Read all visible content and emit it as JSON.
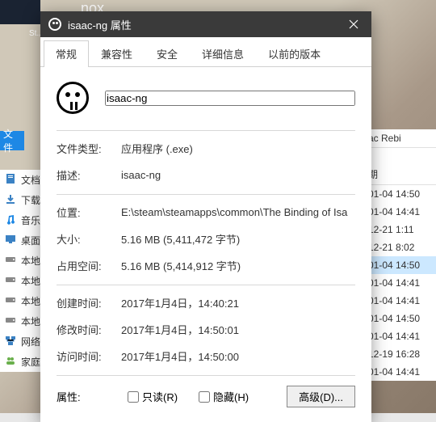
{
  "desktop": {
    "nox_label": "nox",
    "steam_label": "St..."
  },
  "dialog": {
    "title": "isaac-ng 属性",
    "tabs": [
      "常规",
      "兼容性",
      "安全",
      "详细信息",
      "以前的版本"
    ],
    "active_tab": 0,
    "filename": "isaac-ng",
    "rows": {
      "filetype_label": "文件类型:",
      "filetype_value": "应用程序 (.exe)",
      "desc_label": "描述:",
      "desc_value": "isaac-ng",
      "location_label": "位置:",
      "location_value": "E:\\steam\\steamapps\\common\\The Binding of Isa",
      "size_label": "大小:",
      "size_value": "5.16 MB (5,411,472 字节)",
      "sizedisk_label": "占用空间:",
      "sizedisk_value": "5.16 MB (5,414,912 字节)",
      "created_label": "创建时间:",
      "created_value": "2017年1月4日，14:40:21",
      "modified_label": "修改时间:",
      "modified_value": "2017年1月4日，14:50:01",
      "accessed_label": "访问时间:",
      "accessed_value": "2017年1月4日，14:50:00",
      "attr_label": "属性:",
      "readonly_label": "只读(R)",
      "hidden_label": "隐藏(H)",
      "advanced_label": "高级(D)..."
    }
  },
  "sidebar": {
    "file_btn": "文件",
    "items": [
      {
        "icon": "document",
        "label": "文档",
        "color": "#3b82c4"
      },
      {
        "icon": "download",
        "label": "下载",
        "color": "#3b82c4"
      },
      {
        "icon": "music",
        "label": "音乐",
        "color": "#1e88e5"
      },
      {
        "icon": "desktop",
        "label": "桌面",
        "color": "#3b82c4"
      },
      {
        "icon": "disk",
        "label": "本地",
        "color": "#888"
      },
      {
        "icon": "disk",
        "label": "本地",
        "color": "#888"
      },
      {
        "icon": "disk",
        "label": "本地",
        "color": "#888"
      },
      {
        "icon": "disk",
        "label": "本地",
        "color": "#888"
      },
      {
        "icon": "network",
        "label": "网络",
        "color": "#3b82c4"
      },
      {
        "icon": "homegroup",
        "label": "家庭组",
        "color": "#6ab04c"
      }
    ]
  },
  "right_col": {
    "header": "ac Rebi",
    "date_header": "期",
    "rows": [
      {
        "text": "01-04 14:50",
        "sel": false
      },
      {
        "text": "01-04 14:41",
        "sel": false
      },
      {
        "text": "12-21 1:11",
        "sel": false
      },
      {
        "text": "12-21 8:02",
        "sel": false
      },
      {
        "text": "01-04 14:50",
        "sel": true
      },
      {
        "text": "01-04 14:41",
        "sel": false
      },
      {
        "text": "01-04 14:41",
        "sel": false
      },
      {
        "text": "01-04 14:50",
        "sel": false
      },
      {
        "text": "01-04 14:41",
        "sel": false
      },
      {
        "text": "12-19 16:28",
        "sel": false
      },
      {
        "text": "01-04 14:41",
        "sel": false
      }
    ]
  }
}
